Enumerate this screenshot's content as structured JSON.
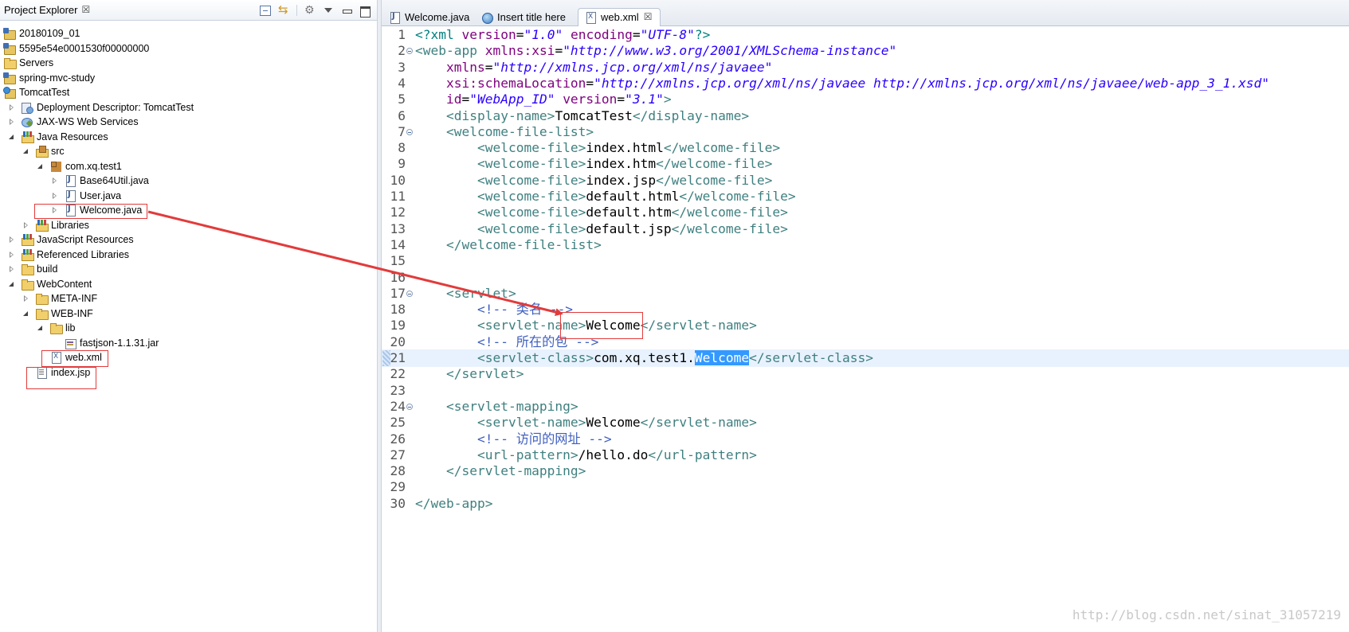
{
  "explorer": {
    "title": "Project Explorer",
    "close_symbol": "☒",
    "tools": [
      "collapse-all-icon",
      "link-with-editor-icon",
      "filters-icon",
      "view-menu-icon",
      "minimize-icon",
      "maximize-icon"
    ],
    "tree": [
      {
        "label": "20180109_01",
        "icon": "project-icon",
        "depth": 0,
        "expander": "none"
      },
      {
        "label": "5595e54e0001530f00000000",
        "icon": "project-icon",
        "depth": 0,
        "expander": "none"
      },
      {
        "label": "Servers",
        "icon": "folder-icon",
        "depth": 0,
        "expander": "none"
      },
      {
        "label": "spring-mvc-study",
        "icon": "project-icon",
        "depth": 0,
        "expander": "none"
      },
      {
        "label": "TomcatTest",
        "icon": "web-project-icon",
        "depth": 0,
        "expander": "none"
      },
      {
        "label": "Deployment Descriptor: TomcatTest",
        "icon": "deployment-descriptor-icon",
        "depth": 1,
        "expander": "closed"
      },
      {
        "label": "JAX-WS Web Services",
        "icon": "web-services-icon",
        "depth": 1,
        "expander": "closed"
      },
      {
        "label": "Java Resources",
        "icon": "java-resources-icon",
        "depth": 1,
        "expander": "open"
      },
      {
        "label": "src",
        "icon": "source-folder-icon",
        "depth": 2,
        "expander": "open"
      },
      {
        "label": "com.xq.test1",
        "icon": "package-icon",
        "depth": 3,
        "expander": "open"
      },
      {
        "label": "Base64Util.java",
        "icon": "java-file-icon",
        "depth": 4,
        "expander": "closed"
      },
      {
        "label": "User.java",
        "icon": "java-file-icon",
        "depth": 4,
        "expander": "closed"
      },
      {
        "label": "Welcome.java",
        "icon": "java-file-icon",
        "depth": 4,
        "expander": "closed"
      },
      {
        "label": "Libraries",
        "icon": "library-icon",
        "depth": 2,
        "expander": "closed"
      },
      {
        "label": "JavaScript Resources",
        "icon": "library-icon",
        "depth": 1,
        "expander": "closed"
      },
      {
        "label": "Referenced Libraries",
        "icon": "library-icon",
        "depth": 1,
        "expander": "closed"
      },
      {
        "label": "build",
        "icon": "folder-icon",
        "depth": 1,
        "expander": "closed"
      },
      {
        "label": "WebContent",
        "icon": "folder-icon",
        "depth": 1,
        "expander": "open"
      },
      {
        "label": "META-INF",
        "icon": "folder-icon",
        "depth": 2,
        "expander": "closed"
      },
      {
        "label": "WEB-INF",
        "icon": "folder-icon",
        "depth": 2,
        "expander": "open"
      },
      {
        "label": "lib",
        "icon": "folder-icon",
        "depth": 3,
        "expander": "open"
      },
      {
        "label": "fastjson-1.1.31.jar",
        "icon": "jar-icon",
        "depth": 4,
        "expander": "none"
      },
      {
        "label": "web.xml",
        "icon": "xml-file-icon",
        "depth": 3,
        "expander": "none"
      },
      {
        "label": "index.jsp",
        "icon": "jsp-file-icon",
        "depth": 2,
        "expander": "none"
      }
    ]
  },
  "editor": {
    "tabs": [
      {
        "label": "Welcome.java",
        "icon": "java-file-icon",
        "active": false
      },
      {
        "label": "Insert title here",
        "icon": "globe-icon",
        "active": false
      },
      {
        "label": "web.xml",
        "icon": "xml-file-icon",
        "active": true,
        "close_symbol": "☒"
      }
    ],
    "current_line": 21,
    "lines": [
      {
        "n": "1",
        "fold": false,
        "tokens": [
          [
            "pi",
            "<?xml "
          ],
          [
            "attr",
            "version"
          ],
          [
            "txt",
            "="
          ],
          [
            "str",
            "\"1.0\""
          ],
          [
            "txt",
            " "
          ],
          [
            "attr",
            "encoding"
          ],
          [
            "txt",
            "="
          ],
          [
            "str",
            "\"UTF-8\""
          ],
          [
            "pi",
            "?>"
          ]
        ]
      },
      {
        "n": "2",
        "fold": true,
        "tokens": [
          [
            "tag",
            "<web-app "
          ],
          [
            "attr",
            "xmlns:xsi"
          ],
          [
            "txt",
            "="
          ],
          [
            "str",
            "\"http://www.w3.org/2001/XMLSchema-instance\""
          ]
        ]
      },
      {
        "n": "3",
        "fold": false,
        "tokens": [
          [
            "txt",
            "    "
          ],
          [
            "attr",
            "xmlns"
          ],
          [
            "txt",
            "="
          ],
          [
            "str",
            "\"http://xmlns.jcp.org/xml/ns/javaee\""
          ]
        ]
      },
      {
        "n": "4",
        "fold": false,
        "tokens": [
          [
            "txt",
            "    "
          ],
          [
            "attr",
            "xsi:schemaLocation"
          ],
          [
            "txt",
            "="
          ],
          [
            "str",
            "\"http://xmlns.jcp.org/xml/ns/javaee http://xmlns.jcp.org/xml/ns/javaee/web-app_3_1.xsd\""
          ]
        ]
      },
      {
        "n": "5",
        "fold": false,
        "tokens": [
          [
            "txt",
            "    "
          ],
          [
            "attr",
            "id"
          ],
          [
            "txt",
            "="
          ],
          [
            "str",
            "\"WebApp_ID\""
          ],
          [
            "txt",
            " "
          ],
          [
            "attr",
            "version"
          ],
          [
            "txt",
            "="
          ],
          [
            "str",
            "\"3.1\""
          ],
          [
            "tag",
            ">"
          ]
        ]
      },
      {
        "n": "6",
        "fold": false,
        "tokens": [
          [
            "txt",
            "    "
          ],
          [
            "tag",
            "<display-name>"
          ],
          [
            "txt",
            "TomcatTest"
          ],
          [
            "tag",
            "</display-name>"
          ]
        ]
      },
      {
        "n": "7",
        "fold": true,
        "tokens": [
          [
            "txt",
            "    "
          ],
          [
            "tag",
            "<welcome-file-list>"
          ]
        ]
      },
      {
        "n": "8",
        "fold": false,
        "tokens": [
          [
            "txt",
            "        "
          ],
          [
            "tag",
            "<welcome-file>"
          ],
          [
            "txt",
            "index.html"
          ],
          [
            "tag",
            "</welcome-file>"
          ]
        ]
      },
      {
        "n": "9",
        "fold": false,
        "tokens": [
          [
            "txt",
            "        "
          ],
          [
            "tag",
            "<welcome-file>"
          ],
          [
            "txt",
            "index.htm"
          ],
          [
            "tag",
            "</welcome-file>"
          ]
        ]
      },
      {
        "n": "10",
        "fold": false,
        "tokens": [
          [
            "txt",
            "        "
          ],
          [
            "tag",
            "<welcome-file>"
          ],
          [
            "txt",
            "index.jsp"
          ],
          [
            "tag",
            "</welcome-file>"
          ]
        ]
      },
      {
        "n": "11",
        "fold": false,
        "tokens": [
          [
            "txt",
            "        "
          ],
          [
            "tag",
            "<welcome-file>"
          ],
          [
            "txt",
            "default.html"
          ],
          [
            "tag",
            "</welcome-file>"
          ]
        ]
      },
      {
        "n": "12",
        "fold": false,
        "tokens": [
          [
            "txt",
            "        "
          ],
          [
            "tag",
            "<welcome-file>"
          ],
          [
            "txt",
            "default.htm"
          ],
          [
            "tag",
            "</welcome-file>"
          ]
        ]
      },
      {
        "n": "13",
        "fold": false,
        "tokens": [
          [
            "txt",
            "        "
          ],
          [
            "tag",
            "<welcome-file>"
          ],
          [
            "txt",
            "default.jsp"
          ],
          [
            "tag",
            "</welcome-file>"
          ]
        ]
      },
      {
        "n": "14",
        "fold": false,
        "tokens": [
          [
            "txt",
            "    "
          ],
          [
            "tag",
            "</welcome-file-list>"
          ]
        ]
      },
      {
        "n": "15",
        "fold": false,
        "tokens": []
      },
      {
        "n": "16",
        "fold": false,
        "tokens": []
      },
      {
        "n": "17",
        "fold": true,
        "tokens": [
          [
            "txt",
            "    "
          ],
          [
            "tag",
            "<servlet>"
          ]
        ]
      },
      {
        "n": "18",
        "fold": false,
        "tokens": [
          [
            "txt",
            "        "
          ],
          [
            "com",
            "<!-- 类名 -->"
          ]
        ]
      },
      {
        "n": "19",
        "fold": false,
        "tokens": [
          [
            "txt",
            "        "
          ],
          [
            "tag",
            "<servlet-name>"
          ],
          [
            "txt",
            "Welcome"
          ],
          [
            "tag",
            "</servlet-name>"
          ]
        ]
      },
      {
        "n": "20",
        "fold": false,
        "tokens": [
          [
            "txt",
            "        "
          ],
          [
            "com",
            "<!-- 所在的包 -->"
          ]
        ]
      },
      {
        "n": "21",
        "fold": false,
        "tokens": [
          [
            "txt",
            "        "
          ],
          [
            "tag",
            "<servlet-class>"
          ],
          [
            "txt",
            "com.xq.test1."
          ],
          [
            "sel",
            "Welcome"
          ],
          [
            "tag",
            "</servlet-class>"
          ]
        ]
      },
      {
        "n": "22",
        "fold": false,
        "tokens": [
          [
            "txt",
            "    "
          ],
          [
            "tag",
            "</servlet>"
          ]
        ]
      },
      {
        "n": "23",
        "fold": false,
        "tokens": []
      },
      {
        "n": "24",
        "fold": true,
        "tokens": [
          [
            "txt",
            "    "
          ],
          [
            "tag",
            "<servlet-mapping>"
          ]
        ]
      },
      {
        "n": "25",
        "fold": false,
        "tokens": [
          [
            "txt",
            "        "
          ],
          [
            "tag",
            "<servlet-name>"
          ],
          [
            "txt",
            "Welcome"
          ],
          [
            "tag",
            "</servlet-name>"
          ]
        ]
      },
      {
        "n": "26",
        "fold": false,
        "tokens": [
          [
            "txt",
            "        "
          ],
          [
            "com",
            "<!-- 访问的网址 -->"
          ]
        ]
      },
      {
        "n": "27",
        "fold": false,
        "tokens": [
          [
            "txt",
            "        "
          ],
          [
            "tag",
            "<url-pattern>"
          ],
          [
            "txt",
            "/hello.do"
          ],
          [
            "tag",
            "</url-pattern>"
          ]
        ]
      },
      {
        "n": "28",
        "fold": false,
        "tokens": [
          [
            "txt",
            "    "
          ],
          [
            "tag",
            "</servlet-mapping>"
          ]
        ]
      },
      {
        "n": "29",
        "fold": false,
        "tokens": []
      },
      {
        "n": "30",
        "fold": false,
        "tokens": [
          [
            "tag",
            "</web-app>"
          ]
        ]
      }
    ]
  },
  "watermark": "http://blog.csdn.net/sinat_31057219",
  "annotation_color": "#e23b3b"
}
